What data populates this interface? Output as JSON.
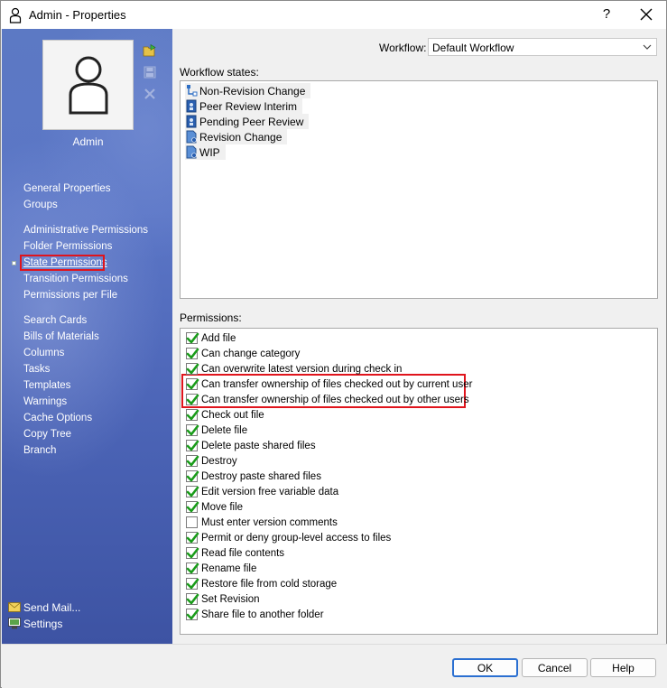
{
  "window": {
    "title": "Admin - Properties",
    "help_glyph": "?"
  },
  "sidebar": {
    "user_name": "Admin",
    "nav_groups": [
      [
        {
          "label": "General Properties"
        },
        {
          "label": "Groups"
        }
      ],
      [
        {
          "label": "Administrative Permissions"
        },
        {
          "label": "Folder Permissions"
        },
        {
          "label": "State Permissions",
          "active": true
        },
        {
          "label": "Transition Permissions"
        },
        {
          "label": "Permissions per File"
        }
      ],
      [
        {
          "label": "Search Cards"
        },
        {
          "label": "Bills of Materials"
        },
        {
          "label": "Columns"
        },
        {
          "label": "Tasks"
        },
        {
          "label": "Templates"
        },
        {
          "label": "Warnings"
        },
        {
          "label": "Cache Options"
        },
        {
          "label": "Copy Tree"
        },
        {
          "label": "Branch"
        }
      ]
    ],
    "footer": [
      {
        "label": "Send Mail...",
        "icon": "mail-icon"
      },
      {
        "label": "Settings",
        "icon": "settings-icon"
      }
    ]
  },
  "workflow": {
    "label": "Workflow:",
    "selected": "Default Workflow"
  },
  "states": {
    "label": "Workflow states:",
    "items": [
      {
        "label": "Non-Revision Change",
        "icon": "workflow-transition-icon"
      },
      {
        "label": "Peer Review Interim",
        "icon": "state-blue-icon"
      },
      {
        "label": "Pending Peer Review",
        "icon": "state-blue-icon"
      },
      {
        "label": "Revision Change",
        "icon": "state-doc-icon"
      },
      {
        "label": "WIP",
        "icon": "state-doc-icon"
      }
    ]
  },
  "permissions": {
    "label": "Permissions:",
    "items": [
      {
        "label": "Add file",
        "checked": true
      },
      {
        "label": "Can change category",
        "checked": true
      },
      {
        "label": "Can overwrite latest version during check in",
        "checked": true
      },
      {
        "label": "Can transfer ownership of files checked out by current user",
        "checked": true
      },
      {
        "label": "Can transfer ownership of files checked out by other users",
        "checked": true
      },
      {
        "label": "Check out file",
        "checked": true
      },
      {
        "label": "Delete file",
        "checked": true
      },
      {
        "label": "Delete paste shared files",
        "checked": true
      },
      {
        "label": "Destroy",
        "checked": true
      },
      {
        "label": "Destroy paste shared files",
        "checked": true
      },
      {
        "label": "Edit version free variable data",
        "checked": true
      },
      {
        "label": "Move file",
        "checked": true
      },
      {
        "label": "Must enter version comments",
        "checked": false
      },
      {
        "label": "Permit or deny group-level access to files",
        "checked": true
      },
      {
        "label": "Read file contents",
        "checked": true
      },
      {
        "label": "Rename file",
        "checked": true
      },
      {
        "label": "Restore file from cold storage",
        "checked": true
      },
      {
        "label": "Set Revision",
        "checked": true
      },
      {
        "label": "Share file to another folder",
        "checked": true
      }
    ]
  },
  "buttons": {
    "ok": "OK",
    "cancel": "Cancel",
    "help": "Help"
  },
  "colors": {
    "highlight": "#e0141c",
    "check": "#1a9c1a",
    "sidebar": "#5570c0"
  }
}
